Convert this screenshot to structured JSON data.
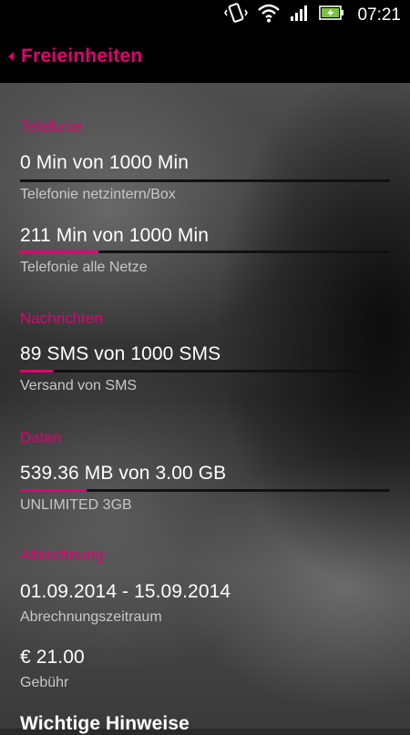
{
  "status_bar": {
    "time": "07:21",
    "icons": [
      "vibrate-icon",
      "wifi-icon",
      "signal-icon",
      "battery-charging-icon"
    ]
  },
  "header": {
    "title": "Freieinheiten"
  },
  "colors": {
    "accent": "#e20074",
    "text": "#ffffff",
    "subtext": "#c8c8c8"
  },
  "sections": {
    "telefonie": {
      "title": "Telefonie",
      "items": [
        {
          "value": "0 Min von 1000 Min",
          "label": "Telefonie netzintern/Box",
          "progress": 0.0
        },
        {
          "value": "211 Min von 1000 Min",
          "label": "Telefonie alle Netze",
          "progress": 0.211
        }
      ]
    },
    "nachrichten": {
      "title": "Nachrichten",
      "items": [
        {
          "value": "89 SMS von 1000 SMS",
          "label": "Versand von SMS",
          "progress": 0.089
        }
      ]
    },
    "daten": {
      "title": "Daten",
      "items": [
        {
          "value": "539.36 MB von 3.00 GB",
          "label": "UNLIMITED 3GB",
          "progress": 0.18
        }
      ]
    },
    "abrechnung": {
      "title": "Abrechnung",
      "items": [
        {
          "value": "01.09.2014 - 15.09.2014",
          "label": "Abrechnungszeitraum"
        },
        {
          "value": "€ 21.00",
          "label": "Gebühr"
        }
      ]
    },
    "hinweise": {
      "title": "Wichtige Hinweise"
    }
  }
}
